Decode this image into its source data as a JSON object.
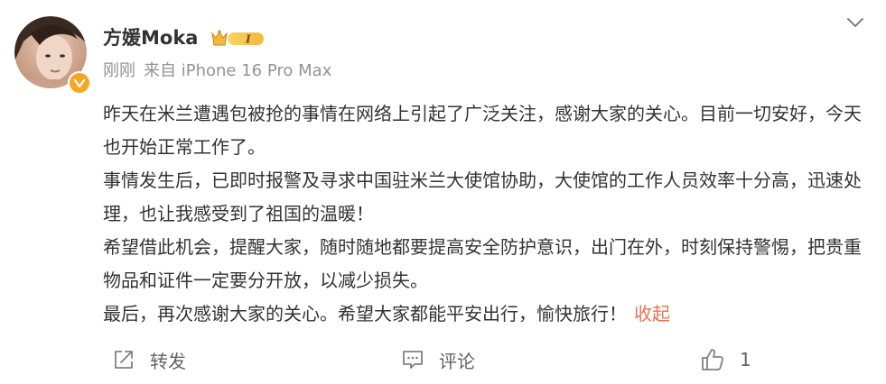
{
  "post": {
    "user": {
      "name": "方媛Moka",
      "level_badge": "I",
      "verified": true
    },
    "meta": {
      "time": "刚刚",
      "source": "来自 iPhone 16 Pro Max"
    },
    "paragraphs": [
      "昨天在米兰遭遇包被抢的事情在网络上引起了广泛关注，感谢大家的关心。目前一切安好，今天也开始正常工作了。",
      "事情发生后，已即时报警及寻求中国驻米兰大使馆协助，大使馆的工作人员效率十分高，迅速处理，也让我感受到了祖国的温暖！",
      "希望借此机会，提醒大家，随时随地都要提高安全防护意识，出门在外，时刻保持警惕，把贵重物品和证件一定要分开放，以减少损失。",
      "最后，再次感谢大家的关心。希望大家都能平安出行，愉快旅行！"
    ],
    "collapse_label": "收起",
    "actions": {
      "forward_label": "转发",
      "comment_label": "评论",
      "like_count": "1"
    }
  },
  "colors": {
    "text": "#333333",
    "meta": "#939393",
    "link": "#eb7350",
    "verify": "#f5a623",
    "action": "#636363"
  }
}
